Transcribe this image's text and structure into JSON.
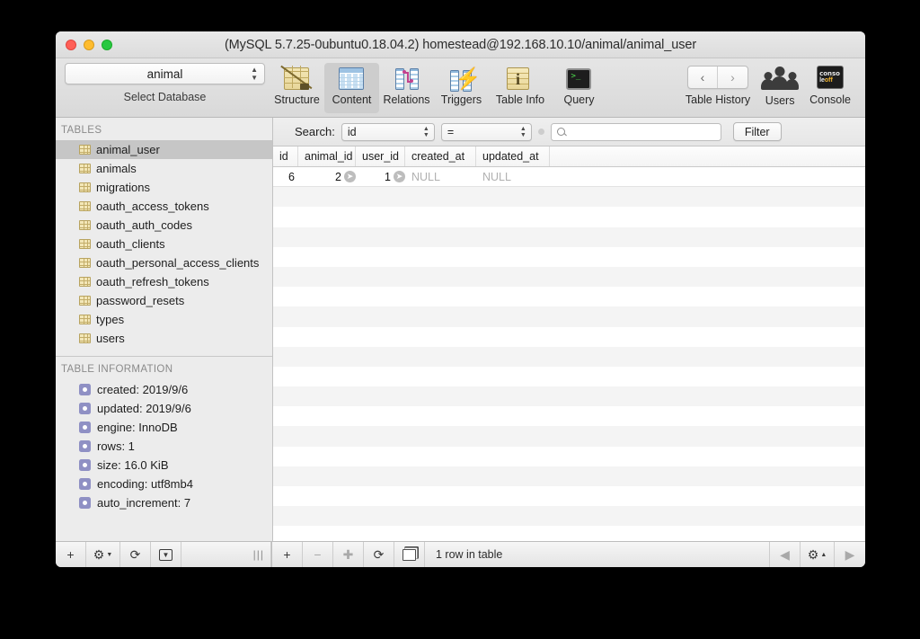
{
  "window": {
    "title": "(MySQL 5.7.25-0ubuntu0.18.04.2) homestead@192.168.10.10/animal/animal_user",
    "traffic_lights": [
      "close",
      "minimize",
      "zoom"
    ]
  },
  "toolbar": {
    "database_selector": {
      "value": "animal",
      "caption": "Select Database"
    },
    "items": [
      {
        "label": "Structure",
        "icon": "structure-icon",
        "active": false
      },
      {
        "label": "Content",
        "icon": "content-icon",
        "active": true
      },
      {
        "label": "Relations",
        "icon": "relations-icon",
        "active": false
      },
      {
        "label": "Triggers",
        "icon": "triggers-icon",
        "active": false
      },
      {
        "label": "Table Info",
        "icon": "table-info-icon",
        "active": false
      },
      {
        "label": "Query",
        "icon": "query-icon",
        "active": false
      }
    ],
    "right_items": [
      {
        "label": "Table History",
        "icon": "history-arrows-icon"
      },
      {
        "label": "Users",
        "icon": "users-icon"
      },
      {
        "label": "Console",
        "icon": "console-off-icon"
      }
    ],
    "history_back": "‹",
    "history_forward": "›",
    "console_icon_text_line1": "conso",
    "console_icon_text_line2a": "le",
    "console_icon_text_line2b": "off"
  },
  "sidebar": {
    "tables_header": "TABLES",
    "tables": [
      {
        "label": "animal_user",
        "selected": true
      },
      {
        "label": "animals",
        "selected": false
      },
      {
        "label": "migrations",
        "selected": false
      },
      {
        "label": "oauth_access_tokens",
        "selected": false
      },
      {
        "label": "oauth_auth_codes",
        "selected": false
      },
      {
        "label": "oauth_clients",
        "selected": false
      },
      {
        "label": "oauth_personal_access_clients",
        "selected": false
      },
      {
        "label": "oauth_refresh_tokens",
        "selected": false
      },
      {
        "label": "password_resets",
        "selected": false
      },
      {
        "label": "types",
        "selected": false
      },
      {
        "label": "users",
        "selected": false
      }
    ],
    "table_information_header": "TABLE INFORMATION",
    "table_information": [
      {
        "label": "created: 2019/9/6"
      },
      {
        "label": "updated: 2019/9/6"
      },
      {
        "label": "engine: InnoDB"
      },
      {
        "label": "rows: 1"
      },
      {
        "label": "size: 16.0 KiB"
      },
      {
        "label": "encoding: utf8mb4"
      },
      {
        "label": "auto_increment: 7"
      }
    ]
  },
  "search": {
    "label": "Search:",
    "field_value": "id",
    "operator_value": "=",
    "input_value": "",
    "input_placeholder": "",
    "filter_button": "Filter"
  },
  "table": {
    "columns": [
      "id",
      "animal_id",
      "user_id",
      "created_at",
      "updated_at"
    ],
    "rows": [
      {
        "id": "6",
        "animal_id": "2",
        "user_id": "1",
        "created_at": "NULL",
        "updated_at": "NULL"
      }
    ],
    "empty_row_count": 18
  },
  "bottom_bar": {
    "add_table": "+",
    "settings_gear": "⚙",
    "refresh": "⟳",
    "export": "▼",
    "resize_grip": "⫴",
    "add_row": "+",
    "remove_row": "−",
    "duplicate_row": "✚",
    "reload_rows": "⟳",
    "copy_row": "copy-icon",
    "status": "1 row in table",
    "prev_page": "◀",
    "page_gear": "⚙",
    "next_page": "▶"
  },
  "colors": {
    "selection": "#c6c6c6",
    "window_bg": "#ececec",
    "stripe": "#f4f4f4",
    "bullet": "#8f90c4",
    "table_icon": "#f3e7b8"
  }
}
